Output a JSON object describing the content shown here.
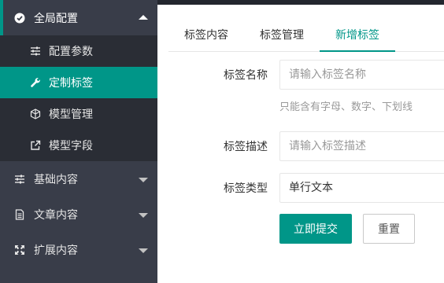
{
  "sidebar": {
    "group_global": {
      "label": "全局配置"
    },
    "sub_items": [
      {
        "label": "配置参数"
      },
      {
        "label": "定制标签"
      },
      {
        "label": "模型管理"
      },
      {
        "label": "模型字段"
      }
    ],
    "group_basic": {
      "label": "基础内容"
    },
    "group_article": {
      "label": "文章内容"
    },
    "group_extend": {
      "label": "扩展内容"
    }
  },
  "tabs": [
    {
      "label": "标签内容"
    },
    {
      "label": "标签管理"
    },
    {
      "label": "新增标签"
    }
  ],
  "form": {
    "name_label": "标签名称",
    "name_placeholder": "请输入标签名称",
    "name_hint": "只能含有字母、数字、下划线",
    "desc_label": "标签描述",
    "desc_placeholder": "请输入标签描述",
    "type_label": "标签类型",
    "type_value": "单行文本",
    "submit_label": "立即提交",
    "reset_label": "重置"
  },
  "colors": {
    "accent": "#009688",
    "sidebar_bg": "#393d49",
    "subnav_bg": "#2a2d35"
  }
}
